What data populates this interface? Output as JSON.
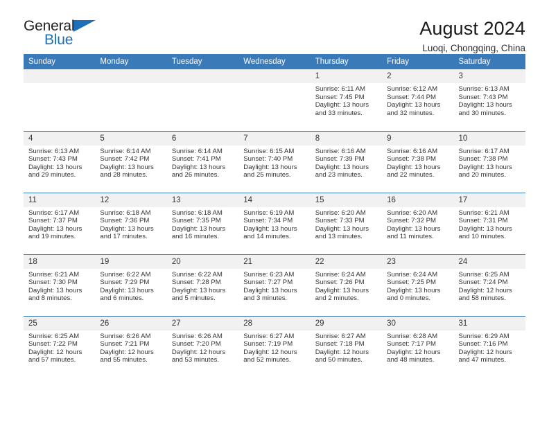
{
  "brand": {
    "name_part1": "General",
    "name_part2": "Blue",
    "accent_color": "#1d70b8"
  },
  "header": {
    "title": "August 2024",
    "subtitle": "Luoqi, Chongqing, China"
  },
  "theme": {
    "header_blue": "#3b7ab9",
    "daynum_band": "#f1f1f1",
    "text": "#333333"
  },
  "calendar": {
    "weekdays": [
      "Sunday",
      "Monday",
      "Tuesday",
      "Wednesday",
      "Thursday",
      "Friday",
      "Saturday"
    ],
    "weeks": [
      [
        {
          "day": "",
          "empty": true,
          "sunrise": "",
          "sunset": "",
          "daylight_line1": "",
          "daylight_line2": ""
        },
        {
          "day": "",
          "empty": true,
          "sunrise": "",
          "sunset": "",
          "daylight_line1": "",
          "daylight_line2": ""
        },
        {
          "day": "",
          "empty": true,
          "sunrise": "",
          "sunset": "",
          "daylight_line1": "",
          "daylight_line2": ""
        },
        {
          "day": "",
          "empty": true,
          "sunrise": "",
          "sunset": "",
          "daylight_line1": "",
          "daylight_line2": ""
        },
        {
          "day": "1",
          "empty": false,
          "sunrise": "Sunrise: 6:11 AM",
          "sunset": "Sunset: 7:45 PM",
          "daylight_line1": "Daylight: 13 hours",
          "daylight_line2": "and 33 minutes."
        },
        {
          "day": "2",
          "empty": false,
          "sunrise": "Sunrise: 6:12 AM",
          "sunset": "Sunset: 7:44 PM",
          "daylight_line1": "Daylight: 13 hours",
          "daylight_line2": "and 32 minutes."
        },
        {
          "day": "3",
          "empty": false,
          "sunrise": "Sunrise: 6:13 AM",
          "sunset": "Sunset: 7:43 PM",
          "daylight_line1": "Daylight: 13 hours",
          "daylight_line2": "and 30 minutes."
        }
      ],
      [
        {
          "day": "4",
          "empty": false,
          "sunrise": "Sunrise: 6:13 AM",
          "sunset": "Sunset: 7:43 PM",
          "daylight_line1": "Daylight: 13 hours",
          "daylight_line2": "and 29 minutes."
        },
        {
          "day": "5",
          "empty": false,
          "sunrise": "Sunrise: 6:14 AM",
          "sunset": "Sunset: 7:42 PM",
          "daylight_line1": "Daylight: 13 hours",
          "daylight_line2": "and 28 minutes."
        },
        {
          "day": "6",
          "empty": false,
          "sunrise": "Sunrise: 6:14 AM",
          "sunset": "Sunset: 7:41 PM",
          "daylight_line1": "Daylight: 13 hours",
          "daylight_line2": "and 26 minutes."
        },
        {
          "day": "7",
          "empty": false,
          "sunrise": "Sunrise: 6:15 AM",
          "sunset": "Sunset: 7:40 PM",
          "daylight_line1": "Daylight: 13 hours",
          "daylight_line2": "and 25 minutes."
        },
        {
          "day": "8",
          "empty": false,
          "sunrise": "Sunrise: 6:16 AM",
          "sunset": "Sunset: 7:39 PM",
          "daylight_line1": "Daylight: 13 hours",
          "daylight_line2": "and 23 minutes."
        },
        {
          "day": "9",
          "empty": false,
          "sunrise": "Sunrise: 6:16 AM",
          "sunset": "Sunset: 7:38 PM",
          "daylight_line1": "Daylight: 13 hours",
          "daylight_line2": "and 22 minutes."
        },
        {
          "day": "10",
          "empty": false,
          "sunrise": "Sunrise: 6:17 AM",
          "sunset": "Sunset: 7:38 PM",
          "daylight_line1": "Daylight: 13 hours",
          "daylight_line2": "and 20 minutes."
        }
      ],
      [
        {
          "day": "11",
          "empty": false,
          "sunrise": "Sunrise: 6:17 AM",
          "sunset": "Sunset: 7:37 PM",
          "daylight_line1": "Daylight: 13 hours",
          "daylight_line2": "and 19 minutes."
        },
        {
          "day": "12",
          "empty": false,
          "sunrise": "Sunrise: 6:18 AM",
          "sunset": "Sunset: 7:36 PM",
          "daylight_line1": "Daylight: 13 hours",
          "daylight_line2": "and 17 minutes."
        },
        {
          "day": "13",
          "empty": false,
          "sunrise": "Sunrise: 6:18 AM",
          "sunset": "Sunset: 7:35 PM",
          "daylight_line1": "Daylight: 13 hours",
          "daylight_line2": "and 16 minutes."
        },
        {
          "day": "14",
          "empty": false,
          "sunrise": "Sunrise: 6:19 AM",
          "sunset": "Sunset: 7:34 PM",
          "daylight_line1": "Daylight: 13 hours",
          "daylight_line2": "and 14 minutes."
        },
        {
          "day": "15",
          "empty": false,
          "sunrise": "Sunrise: 6:20 AM",
          "sunset": "Sunset: 7:33 PM",
          "daylight_line1": "Daylight: 13 hours",
          "daylight_line2": "and 13 minutes."
        },
        {
          "day": "16",
          "empty": false,
          "sunrise": "Sunrise: 6:20 AM",
          "sunset": "Sunset: 7:32 PM",
          "daylight_line1": "Daylight: 13 hours",
          "daylight_line2": "and 11 minutes."
        },
        {
          "day": "17",
          "empty": false,
          "sunrise": "Sunrise: 6:21 AM",
          "sunset": "Sunset: 7:31 PM",
          "daylight_line1": "Daylight: 13 hours",
          "daylight_line2": "and 10 minutes."
        }
      ],
      [
        {
          "day": "18",
          "empty": false,
          "sunrise": "Sunrise: 6:21 AM",
          "sunset": "Sunset: 7:30 PM",
          "daylight_line1": "Daylight: 13 hours",
          "daylight_line2": "and 8 minutes."
        },
        {
          "day": "19",
          "empty": false,
          "sunrise": "Sunrise: 6:22 AM",
          "sunset": "Sunset: 7:29 PM",
          "daylight_line1": "Daylight: 13 hours",
          "daylight_line2": "and 6 minutes."
        },
        {
          "day": "20",
          "empty": false,
          "sunrise": "Sunrise: 6:22 AM",
          "sunset": "Sunset: 7:28 PM",
          "daylight_line1": "Daylight: 13 hours",
          "daylight_line2": "and 5 minutes."
        },
        {
          "day": "21",
          "empty": false,
          "sunrise": "Sunrise: 6:23 AM",
          "sunset": "Sunset: 7:27 PM",
          "daylight_line1": "Daylight: 13 hours",
          "daylight_line2": "and 3 minutes."
        },
        {
          "day": "22",
          "empty": false,
          "sunrise": "Sunrise: 6:24 AM",
          "sunset": "Sunset: 7:26 PM",
          "daylight_line1": "Daylight: 13 hours",
          "daylight_line2": "and 2 minutes."
        },
        {
          "day": "23",
          "empty": false,
          "sunrise": "Sunrise: 6:24 AM",
          "sunset": "Sunset: 7:25 PM",
          "daylight_line1": "Daylight: 13 hours",
          "daylight_line2": "and 0 minutes."
        },
        {
          "day": "24",
          "empty": false,
          "sunrise": "Sunrise: 6:25 AM",
          "sunset": "Sunset: 7:24 PM",
          "daylight_line1": "Daylight: 12 hours",
          "daylight_line2": "and 58 minutes."
        }
      ],
      [
        {
          "day": "25",
          "empty": false,
          "sunrise": "Sunrise: 6:25 AM",
          "sunset": "Sunset: 7:22 PM",
          "daylight_line1": "Daylight: 12 hours",
          "daylight_line2": "and 57 minutes."
        },
        {
          "day": "26",
          "empty": false,
          "sunrise": "Sunrise: 6:26 AM",
          "sunset": "Sunset: 7:21 PM",
          "daylight_line1": "Daylight: 12 hours",
          "daylight_line2": "and 55 minutes."
        },
        {
          "day": "27",
          "empty": false,
          "sunrise": "Sunrise: 6:26 AM",
          "sunset": "Sunset: 7:20 PM",
          "daylight_line1": "Daylight: 12 hours",
          "daylight_line2": "and 53 minutes."
        },
        {
          "day": "28",
          "empty": false,
          "sunrise": "Sunrise: 6:27 AM",
          "sunset": "Sunset: 7:19 PM",
          "daylight_line1": "Daylight: 12 hours",
          "daylight_line2": "and 52 minutes."
        },
        {
          "day": "29",
          "empty": false,
          "sunrise": "Sunrise: 6:27 AM",
          "sunset": "Sunset: 7:18 PM",
          "daylight_line1": "Daylight: 12 hours",
          "daylight_line2": "and 50 minutes."
        },
        {
          "day": "30",
          "empty": false,
          "sunrise": "Sunrise: 6:28 AM",
          "sunset": "Sunset: 7:17 PM",
          "daylight_line1": "Daylight: 12 hours",
          "daylight_line2": "and 48 minutes."
        },
        {
          "day": "31",
          "empty": false,
          "sunrise": "Sunrise: 6:29 AM",
          "sunset": "Sunset: 7:16 PM",
          "daylight_line1": "Daylight: 12 hours",
          "daylight_line2": "and 47 minutes."
        }
      ]
    ]
  }
}
